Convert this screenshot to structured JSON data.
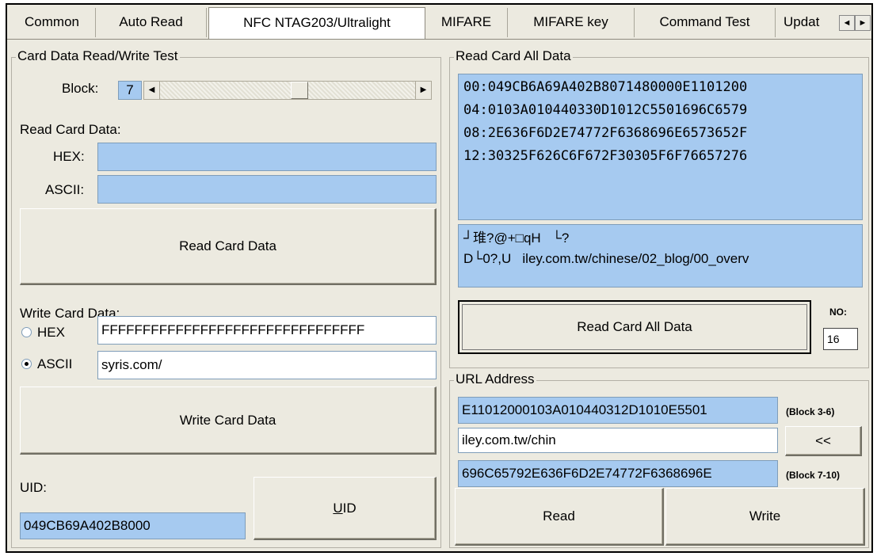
{
  "tabs": [
    {
      "label": "Common"
    },
    {
      "label": "Auto Read"
    },
    {
      "label": "NFC NTAG203/Ultralight",
      "selected": true
    },
    {
      "label": "MIFARE"
    },
    {
      "label": "MIFARE key"
    },
    {
      "label": "Command Test"
    },
    {
      "label": "Updat"
    }
  ],
  "tab_scroll": {
    "left": "◄",
    "right": "►"
  },
  "left": {
    "group_title": "Card Data Read/Write Test",
    "block_label": "Block:",
    "block_value": "7",
    "block_slider_level": 0.55,
    "read_section_label": "Read Card Data:",
    "hex_label": "HEX:",
    "hex_value": "",
    "ascii_label": "ASCII:",
    "ascii_value": "",
    "read_button": "Read Card Data",
    "write_section_label": "Write Card Data:",
    "write_hex_label": "HEX",
    "write_hex_value": "FFFFFFFFFFFFFFFFFFFFFFFFFFFFFFFF",
    "write_ascii_label": "ASCII",
    "write_ascii_value": "syris.com/",
    "write_mode_selected": "ASCII",
    "write_button": "Write Card Data",
    "uid_label": "UID:",
    "uid_value": "049CB69A402B8000",
    "uid_button_prefix": "U",
    "uid_button_rest": "ID"
  },
  "right": {
    "group_title": "Read Card All Data",
    "hex_lines": [
      "00:049CB6A69A402B8071480000E1101200",
      "04:0103A010440330D1012C5501696C6579",
      "08:2E636F6D2E74772F6368696E6573652F",
      "12:30325F626C6F672F30305F6F76657276"
    ],
    "ascii_lines": [
      "┘琟?@+□qH   └?",
      "D└0?,U   iley.com.tw/chinese/02_blog/00_overv"
    ],
    "read_all_button": "Read Card All Data",
    "no_label": "NO:",
    "no_value": "16",
    "url_group_title": "URL Address",
    "url_hex_1": "E11012000103A010440312D1010E5501",
    "url_hex_1_note": "(Block 3-6)",
    "url_text": "iley.com.tw/chin",
    "url_back_button": "<<",
    "url_hex_2": "696C65792E636F6D2E74772F6368696E",
    "url_hex_2_note": "(Block 7-10)",
    "read_button": "Read",
    "write_button": "Write"
  }
}
